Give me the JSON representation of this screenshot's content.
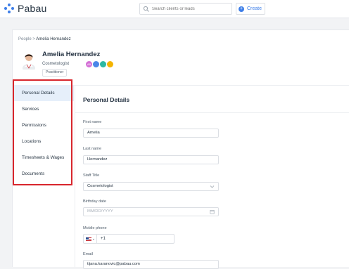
{
  "app": {
    "name": "Pabau"
  },
  "topbar": {
    "search_placeholder": "Search clients or leads",
    "create_label": "Create"
  },
  "breadcrumb": {
    "root": "People",
    "separator": ">",
    "current": "Amelia Hernandez"
  },
  "profile": {
    "name": "Amelia Hernandez",
    "role": "Cosmetologist",
    "badge": "Practitioner",
    "chips": [
      {
        "text": "AB",
        "color": "#d46fd6"
      },
      {
        "text": "",
        "color": "#4a86e8"
      },
      {
        "text": "",
        "color": "#2eb8a3"
      },
      {
        "text": "",
        "color": "#f4b400"
      }
    ]
  },
  "sidebar": {
    "items": [
      {
        "label": "Personal Details",
        "active": true
      },
      {
        "label": "Services",
        "active": false
      },
      {
        "label": "Permissions",
        "active": false
      },
      {
        "label": "Locations",
        "active": false
      },
      {
        "label": "Timesheets & Wages",
        "active": false
      },
      {
        "label": "Documents",
        "active": false
      }
    ]
  },
  "form": {
    "section_title": "Personal Details",
    "first_name": {
      "label": "First name",
      "value": "Amelia"
    },
    "last_name": {
      "label": "Last name",
      "value": "Hernandez"
    },
    "staff_title": {
      "label": "Staff Title",
      "value": "Cosmetologist"
    },
    "birthday": {
      "label": "Birthday date",
      "placeholder": "MM/DD/YYYY"
    },
    "mobile": {
      "label": "Mobile phone",
      "value": "+1"
    },
    "email": {
      "label": "Email",
      "value": "tijana.karanovic@pabau.com"
    }
  },
  "colors": {
    "accent": "#3d7ee8",
    "highlight": "#d8262d",
    "active_bg": "#e6effa"
  }
}
